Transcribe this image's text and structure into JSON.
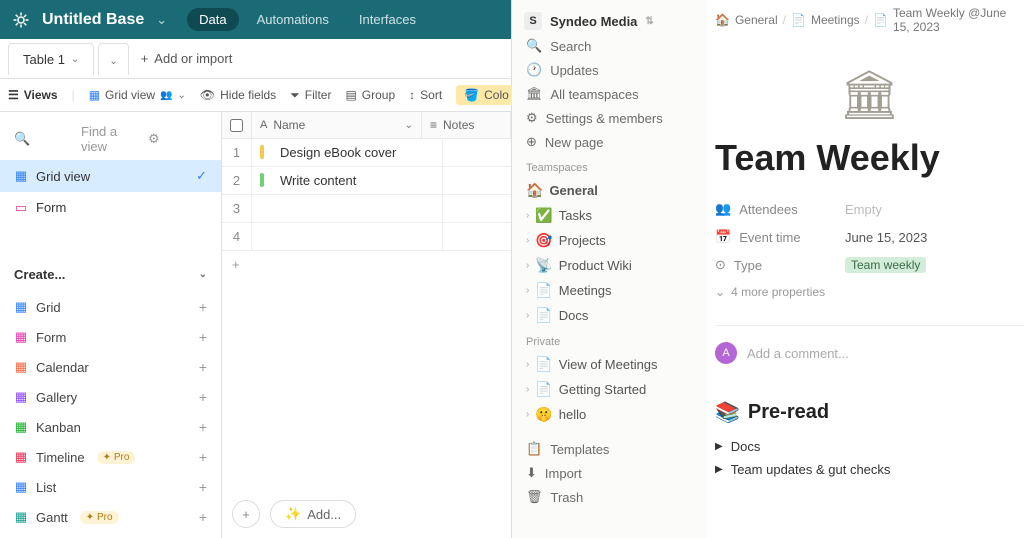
{
  "airtable": {
    "base_title": "Untitled Base",
    "tabs": [
      "Data",
      "Automations",
      "Interfaces"
    ],
    "active_tab": "Data",
    "table_name": "Table 1",
    "add_or_import": "Add or import",
    "toolbar": {
      "views": "Views",
      "grid_view": "Grid view",
      "hide_fields": "Hide fields",
      "filter": "Filter",
      "group": "Group",
      "sort": "Sort",
      "color": "Colo"
    },
    "sidebar": {
      "find_placeholder": "Find a view",
      "views": [
        {
          "label": "Grid view",
          "icon": "grid",
          "color": "#2d7ff9",
          "selected": true
        },
        {
          "label": "Form",
          "icon": "form",
          "color": "#e536ab",
          "selected": false
        }
      ],
      "create_label": "Create...",
      "create_items": [
        {
          "label": "Grid",
          "color": "#2d7ff9",
          "pro": false
        },
        {
          "label": "Form",
          "color": "#e536ab",
          "pro": false
        },
        {
          "label": "Calendar",
          "color": "#f7653b",
          "pro": false
        },
        {
          "label": "Gallery",
          "color": "#8b46ff",
          "pro": false
        },
        {
          "label": "Kanban",
          "color": "#11af22",
          "pro": false
        },
        {
          "label": "Timeline",
          "color": "#e72e53",
          "pro": true
        },
        {
          "label": "List",
          "color": "#2d7ff9",
          "pro": false
        },
        {
          "label": "Gantt",
          "color": "#0f9e8e",
          "pro": true
        }
      ],
      "pro_badge": "Pro"
    },
    "grid": {
      "columns": [
        "Name",
        "Notes"
      ],
      "rows": [
        {
          "num": "1",
          "tag_color": "#f7c74f",
          "name": "Design eBook cover"
        },
        {
          "num": "2",
          "tag_color": "#6dd17a",
          "name": "Write content"
        },
        {
          "num": "3",
          "tag_color": "",
          "name": ""
        },
        {
          "num": "4",
          "tag_color": "",
          "name": ""
        }
      ],
      "add_button": "Add..."
    }
  },
  "notion": {
    "workspace": "Syndeo Media",
    "nav": [
      "Search",
      "Updates",
      "All teamspaces",
      "Settings & members",
      "New page"
    ],
    "sections": {
      "teamspaces": {
        "label": "Teamspaces",
        "root": "General",
        "pages": [
          {
            "emoji": "✅",
            "label": "Tasks"
          },
          {
            "emoji": "🎯",
            "label": "Projects"
          },
          {
            "emoji": "📡",
            "label": "Product Wiki"
          },
          {
            "emoji": "📄",
            "label": "Meetings"
          },
          {
            "emoji": "📄",
            "label": "Docs"
          }
        ]
      },
      "private": {
        "label": "Private",
        "pages": [
          {
            "emoji": "📄",
            "label": "View of Meetings"
          },
          {
            "emoji": "📄",
            "label": "Getting Started"
          },
          {
            "emoji": "🤫",
            "label": "hello"
          }
        ]
      }
    },
    "footer_items": [
      "Templates",
      "Import",
      "Trash"
    ],
    "breadcrumb": [
      "General",
      "Meetings",
      "Team Weekly @June 15, 2023"
    ],
    "page_title": "Team Weekly",
    "properties": [
      {
        "icon": "people",
        "label": "Attendees",
        "value": "Empty"
      },
      {
        "icon": "calendar",
        "label": "Event time",
        "value": "June 15, 2023"
      },
      {
        "icon": "type",
        "label": "Type",
        "value": "Team weekly",
        "tag": true
      }
    ],
    "more_props": "4 more properties",
    "comment_placeholder": "Add a comment...",
    "content": {
      "heading": "Pre-read",
      "toggles": [
        "Docs",
        "Team updates & gut checks"
      ]
    }
  }
}
